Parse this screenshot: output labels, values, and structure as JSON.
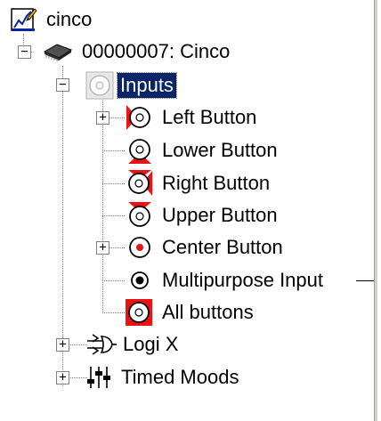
{
  "tree": {
    "root": {
      "label": "cinco",
      "icon": "edit-pencil-icon"
    },
    "device": {
      "label": "00000007: Cinco",
      "icon": "chip-icon",
      "expander": "−"
    },
    "inputs": {
      "label": "Inputs",
      "icon": "inputs-icon",
      "expander": "−"
    },
    "items": [
      {
        "label": "Left Button",
        "icon": "left-button-icon",
        "expander": "+"
      },
      {
        "label": "Lower Button",
        "icon": "lower-button-icon",
        "expander": ""
      },
      {
        "label": "Right Button",
        "icon": "right-button-icon",
        "expander": ""
      },
      {
        "label": "Upper Button",
        "icon": "upper-button-icon",
        "expander": ""
      },
      {
        "label": "Center Button",
        "icon": "center-button-icon",
        "expander": "+"
      },
      {
        "label": "Multipurpose Input",
        "icon": "multipurpose-input-icon",
        "expander": ""
      },
      {
        "label": "All buttons",
        "icon": "all-buttons-icon",
        "expander": ""
      }
    ],
    "logix": {
      "label": "Logi X",
      "icon": "logic-gate-icon",
      "expander": "+"
    },
    "timed_moods": {
      "label": "Timed Moods",
      "icon": "sliders-icon",
      "expander": "+"
    }
  },
  "colors": {
    "accent_red": "#ee1111",
    "selection": "#0a246a"
  }
}
